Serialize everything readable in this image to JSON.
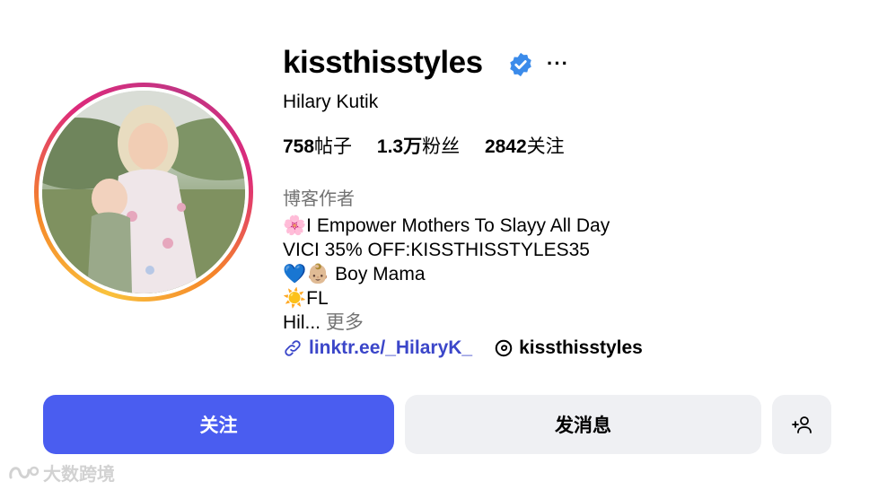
{
  "profile": {
    "username": "kissthisstyles",
    "verified": true,
    "full_name": "Hilary Kutik",
    "stats": [
      {
        "value": "758",
        "label": "帖子"
      },
      {
        "value": "1.3万",
        "label": "粉丝"
      },
      {
        "value": "2842",
        "label": "关注"
      }
    ],
    "category": "博客作者",
    "bio_lines": [
      "🌸I Empower Mothers To Slayy All Day",
      "VICI 35% OFF:KISSTHISSTYLES35",
      "💙👶🏼 Boy Mama",
      "☀️FL",
      "Hil..."
    ],
    "bio_more": "更多",
    "link": "linktr.ee/_HilaryK_",
    "threads_handle": "kissthisstyles"
  },
  "header": {
    "more_glyph": "···"
  },
  "actions": {
    "follow_label": "关注",
    "message_label": "发消息",
    "suggest_icon": "add-person-icon"
  },
  "watermark": {
    "text": "大数跨境"
  },
  "colors": {
    "accent": "#4a5df0",
    "secondary_button": "#eff0f3",
    "verified": "#3b8bea",
    "link": "#3b46c9",
    "muted": "#737373"
  }
}
